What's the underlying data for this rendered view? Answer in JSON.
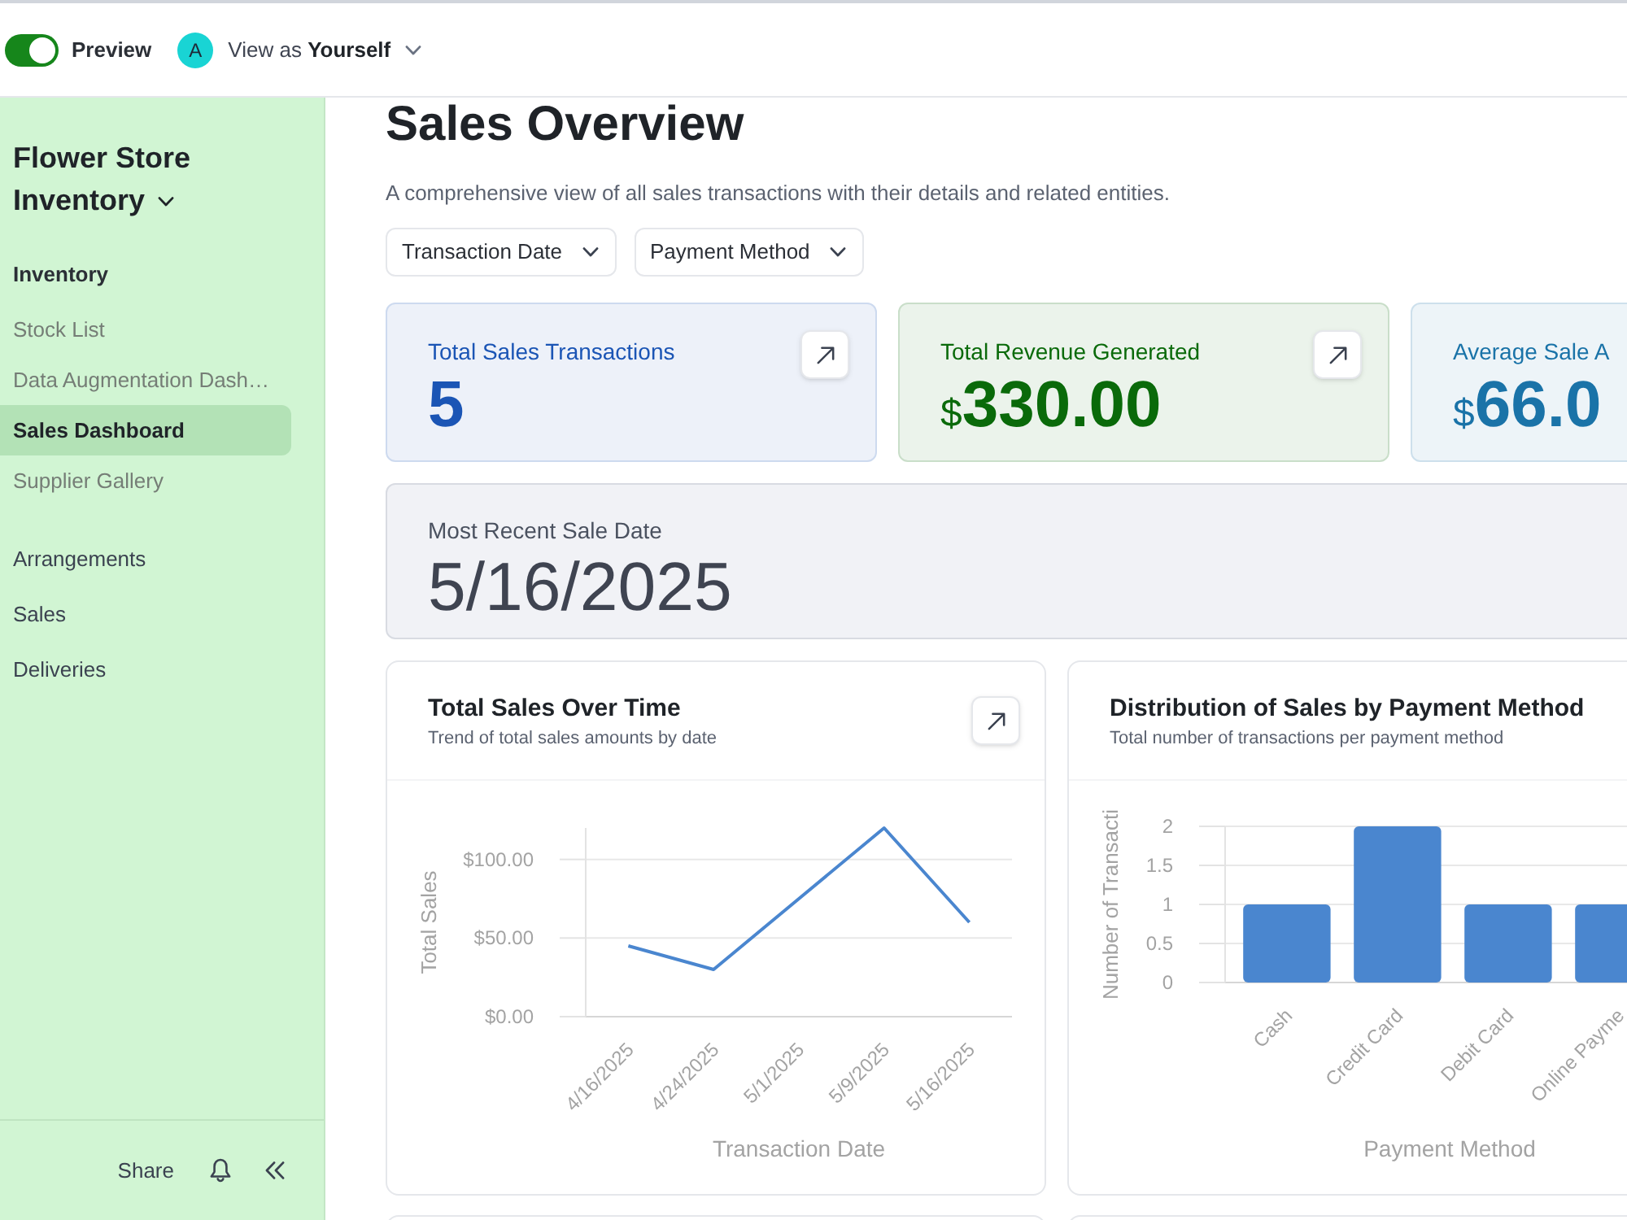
{
  "topbar": {
    "preview": {
      "label": "Preview",
      "on": true
    },
    "viewer": {
      "avatar": "A",
      "label": "View as **Yourself**"
    }
  },
  "sidebar": {
    "title": "Flower Store Inventory",
    "nav": [
      {
        "label": "Inventory",
        "selected": false,
        "children": [
          {
            "label": "Stock List",
            "selected": false
          },
          {
            "label": "Data Augmentation Dash…",
            "selected": false
          },
          {
            "label": "Sales Dashboard",
            "selected": true
          },
          {
            "label": "Supplier Gallery",
            "selected": false
          }
        ]
      },
      {
        "label": "Arrangements",
        "selected": false
      },
      {
        "label": "Sales",
        "selected": false
      },
      {
        "label": "Deliveries",
        "selected": false
      }
    ],
    "footer": {
      "share": "Share"
    }
  },
  "page": {
    "title": "Sales Overview",
    "description": "A comprehensive view of all sales transactions with their details and related entities.",
    "filters": [
      "Transaction Date",
      "Payment Method"
    ]
  },
  "stats": [
    {
      "title": "Total Sales Transactions",
      "value": "5",
      "color": "#1b55b5",
      "expand": true
    },
    {
      "title": "Total Revenue Generated",
      "prefix": "$",
      "value": "330.00",
      "color": "#0a6a0a",
      "expand": true
    },
    {
      "title": "Average Sale A",
      "prefix": "$",
      "value": "66.0",
      "color": "#1a73a8"
    }
  ],
  "latest": {
    "title": "Most Recent Sale Date",
    "value": "5/16/2025"
  },
  "charts": [
    {
      "title": "Total Sales Over Time",
      "subtitle": "Trend of total sales amounts by date",
      "expand": true,
      "chart_data": {
        "type": "line",
        "categories": [
          "4/16/2025",
          "4/24/2025",
          "5/1/2025",
          "5/9/2025",
          "5/16/2025"
        ],
        "values": [
          45,
          30,
          75,
          120,
          60
        ],
        "color": "#4a86cf",
        "xlabel": "Transaction Date",
        "ylabel": "Total Sales",
        "ylim": [
          0,
          120
        ],
        "yticks": [
          {
            "value": 0,
            "label": "$0.00"
          },
          {
            "value": 50,
            "label": "$50.00"
          },
          {
            "value": 100,
            "label": "$100.00"
          }
        ],
        "grid": "y"
      }
    },
    {
      "title": "Distribution of Sales by Payment Method",
      "subtitle": "Total number of transactions per payment method",
      "chart_data": {
        "type": "bar",
        "categories": [
          "Cash",
          "Credit Card",
          "Debit Card",
          "Online Payme"
        ],
        "values": [
          1,
          2,
          1,
          1
        ],
        "color": "#4a86cf",
        "xlabel": "Payment Method",
        "ylabel": "Number of Transacti",
        "ylim": [
          0,
          2
        ],
        "yticks": [
          0,
          0.5,
          1,
          1.5,
          2
        ],
        "grid": "y"
      }
    }
  ]
}
